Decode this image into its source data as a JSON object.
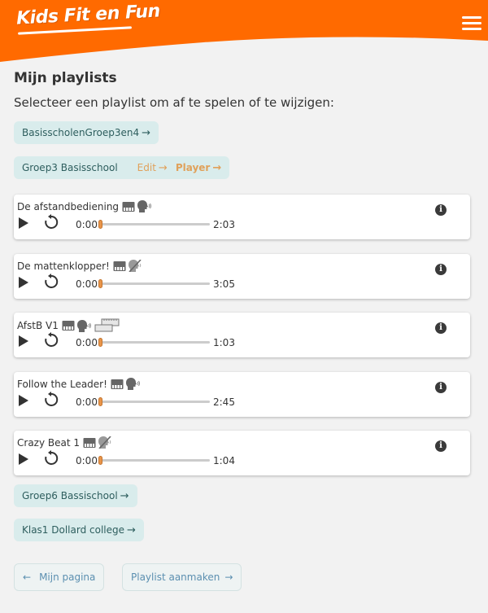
{
  "header": {
    "logo_text": "Kids Fit en Fun",
    "brand_color": "#ff6a00"
  },
  "main": {
    "title": "Mijn playlists",
    "subtitle": "Selecteer een playlist om af te spelen of te wijzigen:"
  },
  "playlists": [
    {
      "name": "BasisscholenGroep3en4",
      "arrow": "→"
    },
    {
      "name": "Groep3 Basisschool",
      "edit_label": "Edit",
      "player_label": "Player",
      "arrow": "→"
    },
    {
      "name": "Groep6 Bassischool",
      "arrow": "→"
    },
    {
      "name": "Klas1 Dollard college",
      "arrow": "→"
    }
  ],
  "tracks": [
    {
      "title": "De afstandbediening",
      "current_time": "0:00",
      "duration": "2:03",
      "progress": 0,
      "icons": [
        "piano-icon",
        "voice-icon"
      ]
    },
    {
      "title": "De mattenklopper!",
      "current_time": "0:00",
      "duration": "3:05",
      "progress": 0,
      "icons": [
        "piano-icon",
        "voice-muted-icon"
      ]
    },
    {
      "title": "AfstB V1",
      "current_time": "0:00",
      "duration": "1:03",
      "progress": 0,
      "icons": [
        "piano-icon",
        "voice-icon",
        "blocks-icon"
      ]
    },
    {
      "title": "Follow the Leader!",
      "current_time": "0:00",
      "duration": "2:45",
      "progress": 0,
      "icons": [
        "piano-icon",
        "voice-icon"
      ]
    },
    {
      "title": "Crazy Beat 1",
      "current_time": "0:00",
      "duration": "1:04",
      "progress": 0,
      "icons": [
        "piano-icon",
        "voice-muted-icon"
      ]
    }
  ],
  "footer": {
    "back_label": "Mijn pagina",
    "back_arrow": "←",
    "create_label": "Playlist aanmaken",
    "create_arrow": "→"
  },
  "info_glyph": "i"
}
